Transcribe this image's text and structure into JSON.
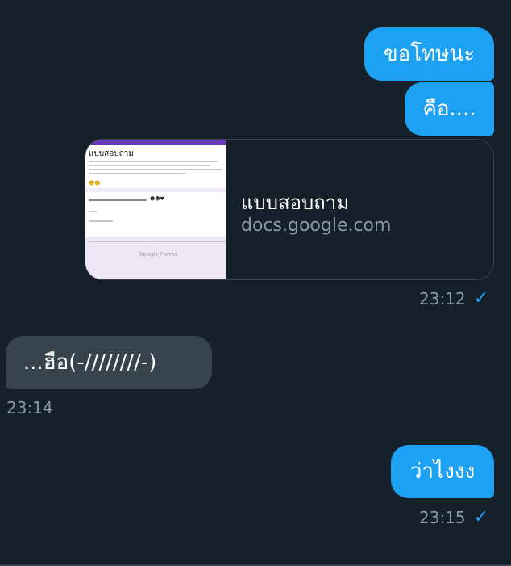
{
  "messages": {
    "out1": {
      "text": "ขอโทษนะ"
    },
    "out2": {
      "text": "คือ...."
    },
    "link_card": {
      "title": "แบบสอบถาม",
      "domain": "docs.google.com",
      "thumbnail": {
        "form_title": "แบบสอบถาม",
        "footer_logo": "Google Forms"
      },
      "time": "23:12"
    },
    "in1": {
      "text": "...ฮือ(-////////-)",
      "time": "23:14"
    },
    "out3": {
      "text": "ว่าไงงง",
      "time": "23:15"
    }
  },
  "colors": {
    "background": "#15202b",
    "outgoing_bubble": "#1da1f2",
    "incoming_bubble": "#38444d",
    "meta_text": "#8899a6",
    "read_check": "#1da1f2"
  },
  "icons": {
    "read_receipt": "checkmark-icon"
  }
}
